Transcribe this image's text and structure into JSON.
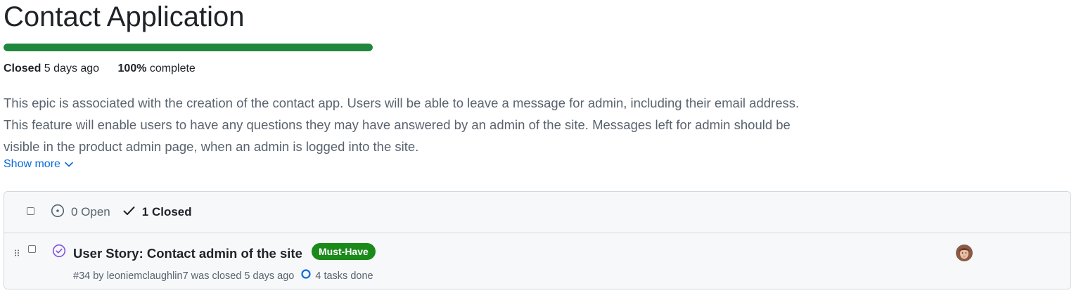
{
  "milestone": {
    "title": "Contact Application",
    "progress_fraction": 1.0,
    "status_label": "Closed",
    "status_time": "5 days ago",
    "percent_value": "100%",
    "percent_suffix": "complete",
    "description": "This epic is associated with the creation of the contact app. Users will be able to leave a message for admin, including their email address. This feature will enable users to have any questions they may have answered by an admin of the site. Messages left for admin should be visible in the product admin page, when an admin is logged into the site.",
    "show_more_label": "Show more"
  },
  "list_header": {
    "open_label": "0 Open",
    "closed_label": "1 Closed"
  },
  "issues": [
    {
      "title": "User Story: Contact admin of the site",
      "label": "Must-Have",
      "label_color": "#1a8a1a",
      "meta": "#34 by leoniemclaughlin7 was closed 5 days ago",
      "tasks": "4 tasks done",
      "state_icon": "closed-check-circle-icon",
      "state_color": "#8250df"
    }
  ],
  "colors": {
    "progress": "#1f883d",
    "link": "#0969da",
    "muted": "#59636e"
  }
}
